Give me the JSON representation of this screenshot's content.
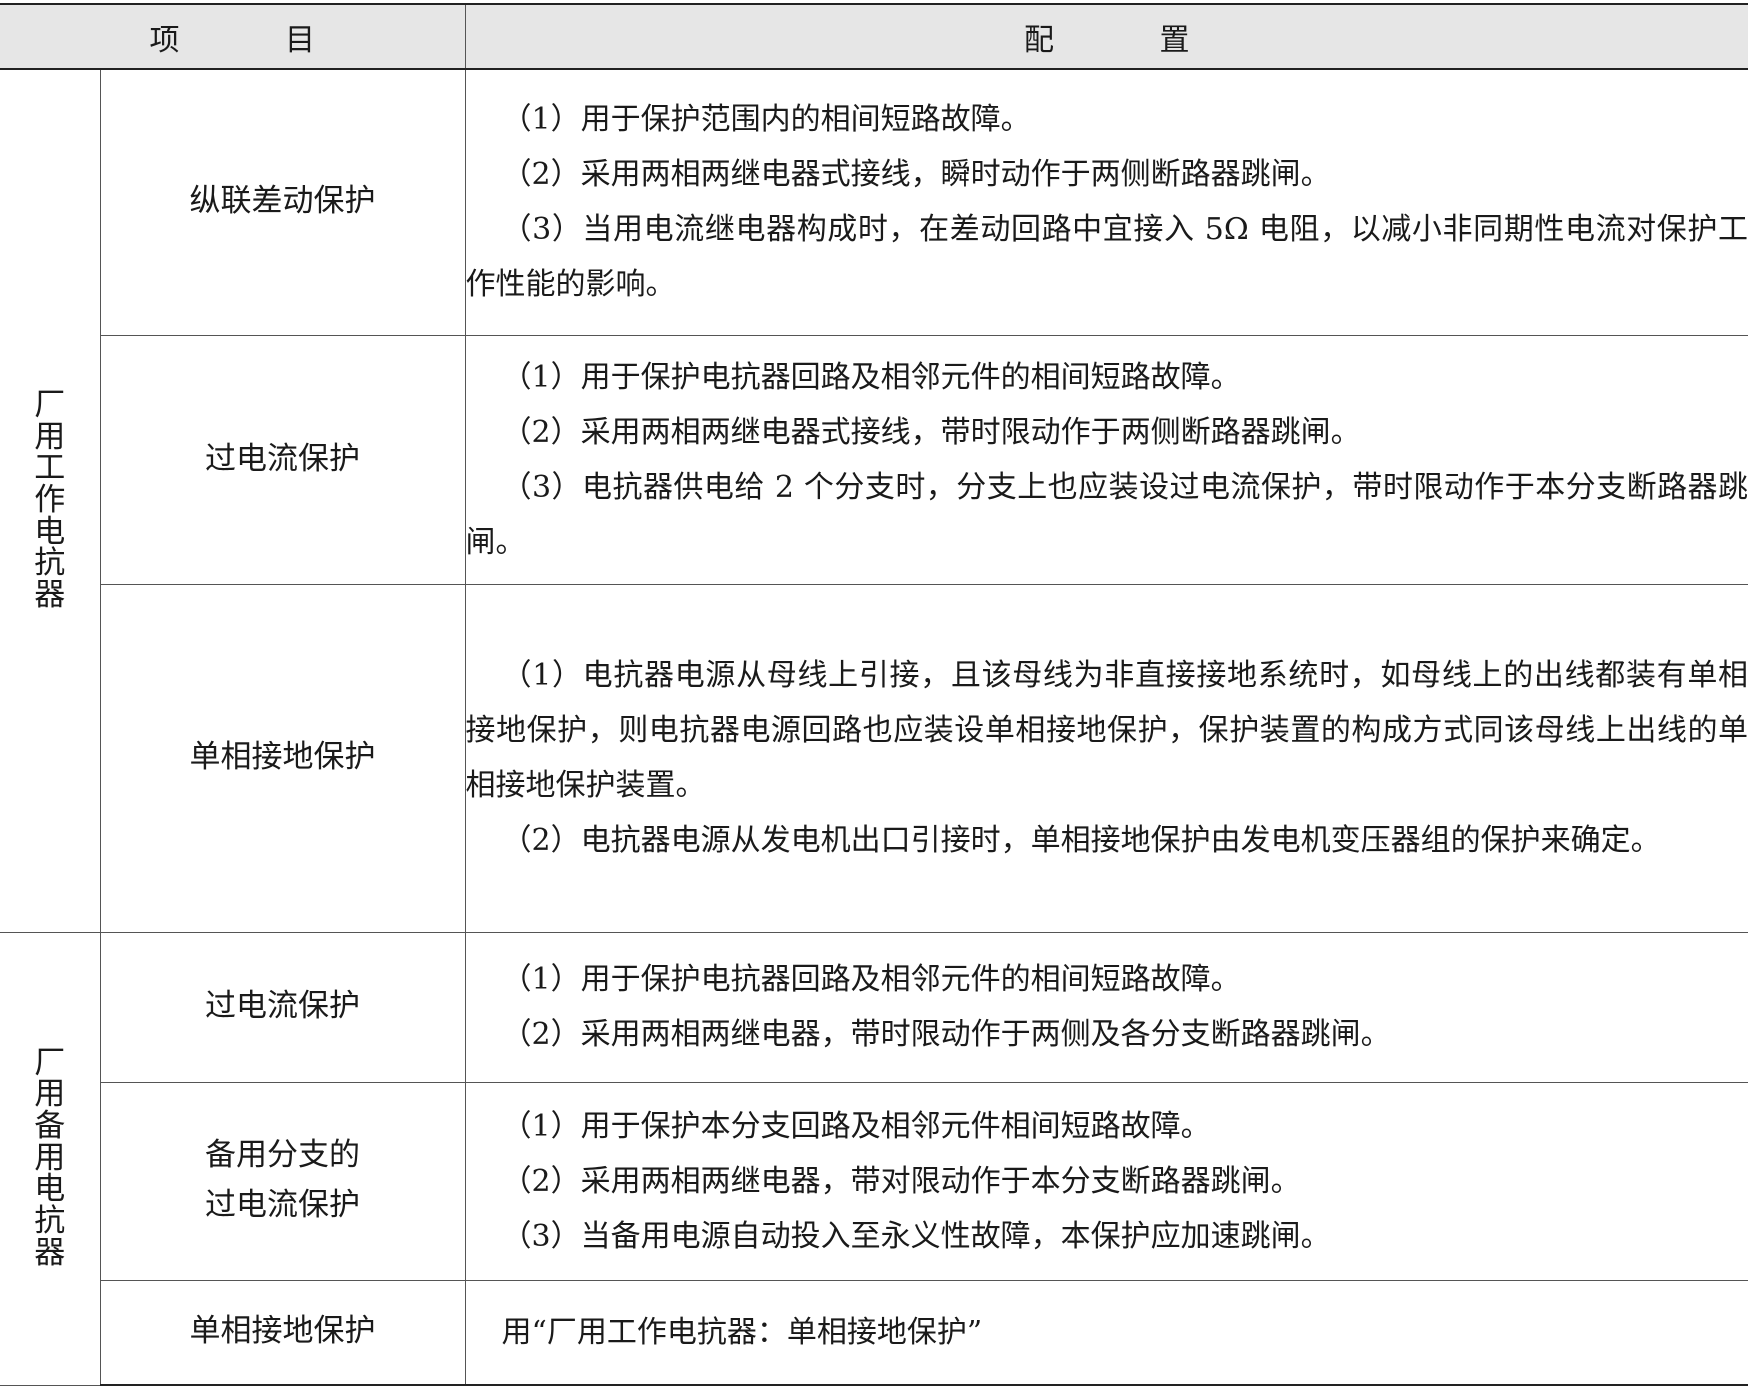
{
  "header": {
    "item": "项 目",
    "config": "配 置"
  },
  "groups": [
    {
      "label": "厂用工作电抗器",
      "rows": [
        {
          "item": "纵联差动保护",
          "lines": [
            "（1）用于保护范围内的相间短路故障。",
            "（2）采用两相两继电器式接线，瞬时动作于两侧断路器跳闸。",
            "（3）当用电流继电器构成时，在差动回路中宜接入 5Ω 电阻，以减小非同期性电流对保护工作性能的影响。"
          ]
        },
        {
          "item": "过电流保护",
          "lines": [
            "（1）用于保护电抗器回路及相邻元件的相间短路故障。",
            "（2）采用两相两继电器式接线，带时限动作于两侧断路器跳闸。",
            "（3）电抗器供电给 2 个分支时，分支上也应装设过电流保护，带时限动作于本分支断路器跳闸。"
          ]
        },
        {
          "item": "单相接地保护",
          "lines": [
            "（1）电抗器电源从母线上引接，且该母线为非直接接地系统时，如母线上的出线都装有单相接地保护，则电抗器电源回路也应装设单相接地保护，保护装置的构成方式同该母线上出线的单相接地保护装置。",
            "（2）电抗器电源从发电机出口引接时，单相接地保护由发电机变压器组的保护来确定。"
          ]
        }
      ]
    },
    {
      "label": "厂用备用电抗器",
      "rows": [
        {
          "item": "过电流保护",
          "lines": [
            "（1）用于保护电抗器回路及相邻元件的相间短路故障。",
            "（2）采用两相两继电器，带时限动作于两侧及各分支断路器跳闸。"
          ]
        },
        {
          "item": "备用分支的过电流保护",
          "item_lines": [
            "备用分支的",
            "过电流保护"
          ],
          "lines": [
            "（1）用于保护本分支回路及相邻元件相间短路故障。",
            "（2）采用两相两继电器，带对限动作于本分支断路器跳闸。",
            "（3）当备用电源自动投入至永义性故障，本保护应加速跳闸。"
          ]
        },
        {
          "item": "单相接地保护",
          "lines": [
            "用“厂用工作电抗器：单相接地保护”"
          ]
        }
      ]
    }
  ]
}
